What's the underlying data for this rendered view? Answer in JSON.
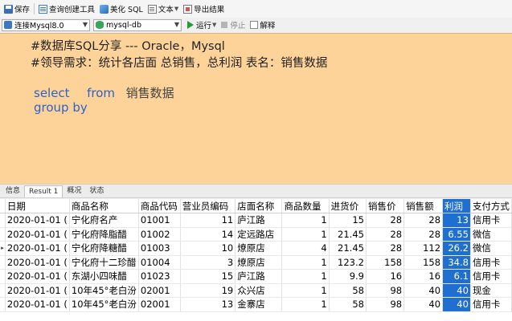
{
  "toolbar": {
    "save": "保存",
    "query_builder": "查询创建工具",
    "beautify": "美化 SQL",
    "text": "文本",
    "export": "导出结果"
  },
  "toolbar2": {
    "connection": "连接Mysql8.0",
    "database": "mysql-db",
    "run": "运行",
    "stop": "停止",
    "explain": "解释"
  },
  "editor": {
    "comment1": "#数据库SQL分享  ---  Oracle，Mysql",
    "comment2": "#领导需求：统计各店面 总销售，总利润    表名：销售数据",
    "kw_select": "select",
    "kw_from": "from",
    "table_name": "销售数据",
    "kw_groupby": "group by"
  },
  "tabs": [
    "信息",
    "Result 1",
    "概况",
    "状态"
  ],
  "grid": {
    "columns": [
      "日期",
      "商品名称",
      "商品代码",
      "营业员编码",
      "店面名称",
      "商品数量",
      "进货价",
      "销售价",
      "销售额",
      "利润",
      "支付方式"
    ],
    "rows": [
      [
        "2020-01-01 (",
        "宁化府名产",
        "01001",
        "11",
        "庐江路",
        "1",
        "15",
        "28",
        "28",
        "13",
        "信用卡"
      ],
      [
        "2020-01-01 (",
        "宁化府降脂醋",
        "01002",
        "14",
        "定远路店",
        "1",
        "21.45",
        "28",
        "28",
        "6.55",
        "微信"
      ],
      [
        "2020-01-01 (",
        "宁化府降糖醋",
        "01003",
        "10",
        "燎原店",
        "4",
        "21.45",
        "28",
        "112",
        "26.2",
        "微信"
      ],
      [
        "2020-01-01 (",
        "宁化府十二珍醋",
        "01004",
        "3",
        "燎原店",
        "1",
        "123.2",
        "158",
        "158",
        "34.8",
        "信用卡"
      ],
      [
        "2020-01-01 (",
        "东湖小四味醋",
        "01023",
        "15",
        "庐江路",
        "1",
        "9.9",
        "16",
        "16",
        "6.1",
        "信用卡"
      ],
      [
        "2020-01-01 (",
        "10年45°老白汾",
        "02001",
        "19",
        "众兴店",
        "1",
        "58",
        "98",
        "40",
        "40",
        "现金"
      ],
      [
        "2020-01-01 (",
        "10年45°老白汾",
        "02001",
        "13",
        "金寨店",
        "1",
        "58",
        "98",
        "40",
        "40",
        "信用卡"
      ]
    ],
    "row_marker": "▸"
  }
}
